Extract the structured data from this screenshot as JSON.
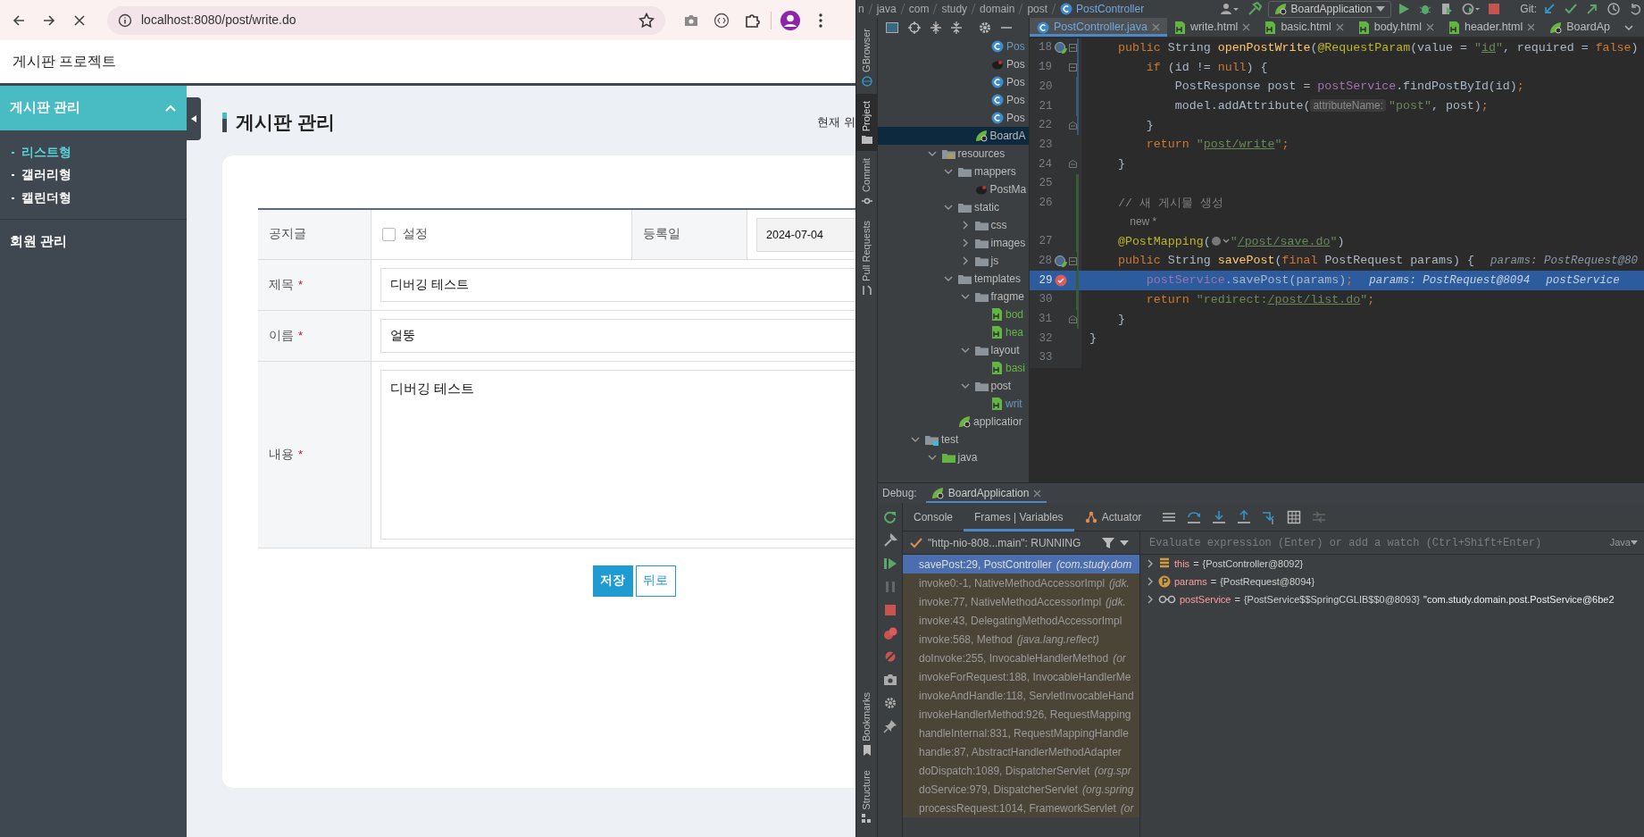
{
  "browser": {
    "address": "localhost:8080/post/write.do"
  },
  "site": {
    "title": "게시판 프로젝트",
    "sidebar": [
      {
        "label": "게시판 관리",
        "expanded": true,
        "children": [
          {
            "label": "리스트형",
            "selected": true
          },
          {
            "label": "갤러리형",
            "selected": false
          },
          {
            "label": "캘린더형",
            "selected": false
          }
        ]
      },
      {
        "label": "회원 관리",
        "expanded": false
      }
    ],
    "page_title": "게시판 관리",
    "breadcrumb": "현재 위",
    "form": {
      "notice": {
        "label": "공지글",
        "option": "설정",
        "checked": false
      },
      "date": {
        "label": "등록일",
        "value": "2024-07-04"
      },
      "fields": [
        {
          "kind": "input",
          "label": "제목",
          "mark": "*",
          "value": "디버깅 테스트"
        },
        {
          "kind": "input",
          "label": "이름",
          "mark": "*",
          "value": "얼뚱"
        },
        {
          "kind": "textarea",
          "label": "내용",
          "mark": "*",
          "value": "디버깅 테스트"
        }
      ]
    },
    "buttons": [
      {
        "kind": "save",
        "label": "저장"
      },
      {
        "kind": "back",
        "label": "뒤로"
      }
    ]
  },
  "ide": {
    "breadcrumbs": [
      "n",
      "java",
      "com",
      "study",
      "domain",
      "post",
      "PostController"
    ],
    "run_config": "BoardApplication",
    "vcs_label": "Git:",
    "tool_windows": {
      "top": [
        {
          "label": "GBrowser",
          "selected": false
        },
        {
          "label": "Project",
          "selected": true
        },
        {
          "label": "Commit",
          "selected": false
        },
        {
          "label": "Pull Requests",
          "selected": false
        }
      ],
      "bottom": [
        {
          "label": "Bookmarks",
          "selected": false
        },
        {
          "label": "Structure",
          "selected": false
        }
      ]
    },
    "editor_tabs": [
      {
        "label": "PostController.java",
        "kind": "java",
        "selected": true,
        "closable": true
      },
      {
        "label": "write.html",
        "kind": "html",
        "selected": false,
        "closable": true
      },
      {
        "label": "basic.html",
        "kind": "html",
        "selected": false,
        "closable": true
      },
      {
        "label": "body.html",
        "kind": "html",
        "selected": false,
        "closable": true
      },
      {
        "label": "header.html",
        "kind": "html",
        "selected": false,
        "closable": true
      },
      {
        "label": "BoardAp",
        "kind": "spring",
        "selected": false,
        "closable": false
      }
    ],
    "project_tree": [
      {
        "children": [
          {
            "children": [
              {
                "children": [
                  {
                    "children": [
                      {
                        "label": "Pos",
                        "kind": "class",
                        "selected": false,
                        "color": "#6897bb"
                      },
                      {
                        "label": "Pos",
                        "kind": "mapper",
                        "selected": false
                      },
                      {
                        "label": "Pos",
                        "kind": "class",
                        "selected": false
                      },
                      {
                        "label": "Pos",
                        "kind": "class",
                        "selected": false
                      },
                      {
                        "label": "Pos",
                        "kind": "class",
                        "selected": false
                      }
                    ]
                  },
                  {
                    "label": "BoardA",
                    "kind": "spring",
                    "selected": true
                  }
                ]
              }
            ]
          },
          {
            "label": "resources",
            "kind": "resources",
            "expanded": true,
            "selected": false,
            "children": [
              {
                "label": "mappers",
                "kind": "folder",
                "expanded": true,
                "selected": false,
                "children": [
                  {
                    "label": "PostMa",
                    "kind": "mapper",
                    "selected": false
                  }
                ]
              },
              {
                "label": "static",
                "kind": "folder",
                "expanded": true,
                "selected": false,
                "children": [
                  {
                    "label": "css",
                    "kind": "folder",
                    "expanded": false,
                    "selected": false
                  },
                  {
                    "label": "images",
                    "kind": "folder",
                    "expanded": false,
                    "selected": false
                  },
                  {
                    "label": "js",
                    "kind": "folder",
                    "expanded": false,
                    "selected": false
                  }
                ]
              },
              {
                "label": "templates",
                "kind": "folder",
                "expanded": true,
                "selected": false,
                "children": [
                  {
                    "label": "fragme",
                    "kind": "folder",
                    "expanded": true,
                    "selected": false,
                    "children": [
                      {
                        "label": "bod",
                        "kind": "html",
                        "selected": false,
                        "color": "#62b543"
                      },
                      {
                        "label": "hea",
                        "kind": "html",
                        "selected": false,
                        "color": "#62b543"
                      }
                    ]
                  },
                  {
                    "label": "layout",
                    "kind": "folder",
                    "expanded": true,
                    "selected": false,
                    "children": [
                      {
                        "label": "basi",
                        "kind": "html",
                        "selected": false,
                        "color": "#62b543"
                      }
                    ]
                  },
                  {
                    "label": "post",
                    "kind": "folder",
                    "expanded": true,
                    "selected": false,
                    "children": [
                      {
                        "label": "writ",
                        "kind": "html",
                        "selected": false,
                        "color": "#6897bb"
                      }
                    ]
                  }
                ]
              },
              {
                "label": "applicatior",
                "kind": "spring",
                "selected": false
              }
            ]
          }
        ]
      },
      {
        "label": "test",
        "kind": "test",
        "expanded": true,
        "selected": false,
        "children": [
          {
            "label": "java",
            "kind": "source",
            "expanded": true,
            "selected": false
          }
        ]
      }
    ],
    "code_lines": [
      {
        "number": "18",
        "gutter": [
          {
            "kind": "web"
          },
          {
            "kind": "fold_start"
          },
          {
            "kind": "modified"
          }
        ],
        "highlighted": false,
        "segments": [
          {
            "kind": "kw",
            "text": "    public"
          },
          {
            "kind": "plain",
            "text": "String"
          },
          {
            "kind": "method",
            "text": "openPostWrite"
          },
          {
            "kind": "plain",
            "text": "("
          },
          {
            "kind": "ann",
            "text": "@RequestParam"
          },
          {
            "kind": "plain",
            "text": "(value ="
          },
          {
            "kind": "str",
            "text": "\""
          },
          {
            "kind": "link",
            "text": "id"
          },
          {
            "kind": "str",
            "text": "\""
          },
          {
            "kind": "plain",
            "text": ", required ="
          },
          {
            "kind": "kw",
            "text": "false"
          },
          {
            "kind": "plain",
            "text": ")"
          }
        ]
      },
      {
        "number": "19",
        "gutter": [
          {
            "kind": "fold_start"
          },
          {
            "kind": "modified"
          }
        ],
        "highlighted": false,
        "segments": [
          {
            "kind": "kw",
            "text": "        if"
          },
          {
            "kind": "plain",
            "text": "(id !="
          },
          {
            "kind": "kw",
            "text": "null"
          },
          {
            "kind": "plain",
            "text": ") {"
          }
        ]
      },
      {
        "number": "20",
        "gutter": [
          {
            "kind": "modified"
          }
        ],
        "highlighted": false,
        "segments": [
          {
            "kind": "plain",
            "text": "            PostResponse post ="
          },
          {
            "kind": "field",
            "text": "postService"
          },
          {
            "kind": "plain",
            "text": ".findPostById(id)"
          },
          {
            "kind": "kw",
            "text": ";"
          }
        ]
      },
      {
        "number": "21",
        "gutter": [
          {
            "kind": "modified"
          }
        ],
        "highlighted": false,
        "segments": [
          {
            "kind": "plain",
            "text": "            model.addAttribute("
          },
          {
            "kind": "hint",
            "text": "attributeName:"
          },
          {
            "kind": "str",
            "text": "\"post\""
          },
          {
            "kind": "plain",
            "text": ", post)"
          },
          {
            "kind": "kw",
            "text": ";"
          }
        ]
      },
      {
        "number": "22",
        "gutter": [
          {
            "kind": "fold_end"
          },
          {
            "kind": "modified"
          }
        ],
        "highlighted": false,
        "segments": [
          {
            "kind": "plain",
            "text": "        }"
          }
        ]
      },
      {
        "number": "23",
        "highlighted": false,
        "segments": [
          {
            "kind": "kw",
            "text": "        return"
          },
          {
            "kind": "str",
            "text": "\""
          },
          {
            "kind": "link",
            "text": "post/write"
          },
          {
            "kind": "str",
            "text": "\""
          },
          {
            "kind": "kw",
            "text": ";"
          }
        ]
      },
      {
        "number": "24",
        "gutter": [
          {
            "kind": "fold_end"
          }
        ],
        "highlighted": false,
        "segments": [
          {
            "kind": "plain",
            "text": "    }"
          }
        ]
      },
      {
        "number": "25",
        "gutter": [
          {
            "kind": "added"
          }
        ],
        "highlighted": false
      },
      {
        "number": "26",
        "gutter": [
          {
            "kind": "added"
          }
        ],
        "highlighted": false,
        "segments": [
          {
            "kind": "comment",
            "text": "    // 새 게시물 생성"
          }
        ]
      },
      {
        "gutter": [
          {
            "kind": "added"
          }
        ],
        "highlighted": false,
        "segments": [
          {
            "kind": "inlay",
            "text": "    new *"
          }
        ]
      },
      {
        "number": "27",
        "gutter": [
          {
            "kind": "added"
          }
        ],
        "highlighted": false,
        "segments": [
          {
            "kind": "ann",
            "text": "    @PostMapping"
          },
          {
            "kind": "plain",
            "text": "("
          },
          {
            "kind": "globe"
          },
          {
            "kind": "str",
            "text": "\""
          },
          {
            "kind": "link",
            "text": "/post/save.do"
          },
          {
            "kind": "str",
            "text": "\""
          },
          {
            "kind": "plain",
            "text": ")"
          }
        ]
      },
      {
        "number": "28",
        "gutter": [
          {
            "kind": "web"
          },
          {
            "kind": "fold_start"
          },
          {
            "kind": "added"
          }
        ],
        "highlighted": false,
        "segments": [
          {
            "kind": "kw",
            "text": "    public"
          },
          {
            "kind": "plain",
            "text": "String"
          },
          {
            "kind": "method",
            "text": "savePost"
          },
          {
            "kind": "plain",
            "text": "("
          },
          {
            "kind": "kw",
            "text": "final"
          },
          {
            "kind": "plain",
            "text": "PostRequest params) {"
          },
          {
            "kind": "debug",
            "text": "params: PostRequest@80"
          }
        ]
      },
      {
        "number": "29",
        "gutter": [
          {
            "kind": "breakpoint"
          },
          {
            "kind": "added"
          }
        ],
        "highlighted": true,
        "segments": [
          {
            "kind": "field",
            "text": "        postService"
          },
          {
            "kind": "plain",
            "text": ".savePost(params)"
          },
          {
            "kind": "kw",
            "text": ";"
          },
          {
            "kind": "debug",
            "text": "params: PostRequest@8094"
          },
          {
            "kind": "debug",
            "text": "postService"
          }
        ]
      },
      {
        "number": "30",
        "gutter": [
          {
            "kind": "added"
          }
        ],
        "highlighted": false,
        "segments": [
          {
            "kind": "kw",
            "text": "        return"
          },
          {
            "kind": "str",
            "text": "\"redirect:"
          },
          {
            "kind": "link",
            "text": "/post/list.do"
          },
          {
            "kind": "str",
            "text": "\""
          },
          {
            "kind": "kw",
            "text": ";"
          }
        ]
      },
      {
        "number": "31",
        "gutter": [
          {
            "kind": "fold_end"
          },
          {
            "kind": "added"
          }
        ],
        "highlighted": false,
        "segments": [
          {
            "kind": "plain",
            "text": "    }"
          }
        ]
      },
      {
        "number": "32",
        "highlighted": false,
        "segments": [
          {
            "kind": "plain",
            "text": "}"
          }
        ]
      },
      {
        "number": "33",
        "highlighted": false
      }
    ],
    "debug": {
      "label": "Debug:",
      "session": "BoardApplication",
      "tabs": [
        {
          "label": "Console",
          "kind": "console",
          "selected": false
        },
        {
          "label": "Frames | Variables",
          "kind": "frames",
          "selected": true
        },
        {
          "label": "Actuator",
          "kind": "actuator",
          "selected": false
        }
      ],
      "thread": "\"http-nio-808...main\": RUNNING",
      "frames": [
        {
          "method": "savePost:29, PostController",
          "package": "(com.study.dom",
          "selected": true
        },
        {
          "method": "invoke0:-1, NativeMethodAccessorImpl",
          "package": "(jdk.",
          "selected": false
        },
        {
          "method": "invoke:77, NativeMethodAccessorImpl",
          "package": "(jdk.",
          "selected": false
        },
        {
          "method": "invoke:43, DelegatingMethodAccessorImpl",
          "selected": false
        },
        {
          "method": "invoke:568, Method",
          "package": "(java.lang.reflect)",
          "selected": false
        },
        {
          "method": "doInvoke:255, InvocableHandlerMethod",
          "package": "(or",
          "selected": false
        },
        {
          "method": "invokeForRequest:188, InvocableHandlerMe",
          "selected": false
        },
        {
          "method": "invokeAndHandle:118, ServletInvocableHand",
          "selected": false
        },
        {
          "method": "invokeHandlerMethod:926, RequestMapping",
          "selected": false
        },
        {
          "method": "handleInternal:831, RequestMappingHandle",
          "selected": false
        },
        {
          "method": "handle:87, AbstractHandlerMethodAdapter",
          "selected": false
        },
        {
          "method": "doDispatch:1089, DispatcherServlet",
          "package": "(org.spr",
          "selected": false
        },
        {
          "method": "doService:979, DispatcherServlet",
          "package": "(org.spring",
          "selected": false
        },
        {
          "method": "processRequest:1014, FrameworkServlet",
          "package": "(or",
          "selected": false
        }
      ],
      "evaluate_placeholder": "Evaluate expression (Enter) or add a watch (Ctrl+Shift+Enter)",
      "language": "Java",
      "variables": [
        {
          "kind": "field",
          "name": "this",
          "equals": "=",
          "value": "{PostController@8092}"
        },
        {
          "kind": "param",
          "name": "params",
          "equals": "=",
          "value": "{PostRequest@8094}"
        },
        {
          "kind": "watch",
          "name": "postService",
          "equals": "=",
          "value": "{PostService$$SpringCGLIB$$0@8093}",
          "text": "\"com.study.domain.post.PostService@6be2"
        }
      ]
    }
  }
}
